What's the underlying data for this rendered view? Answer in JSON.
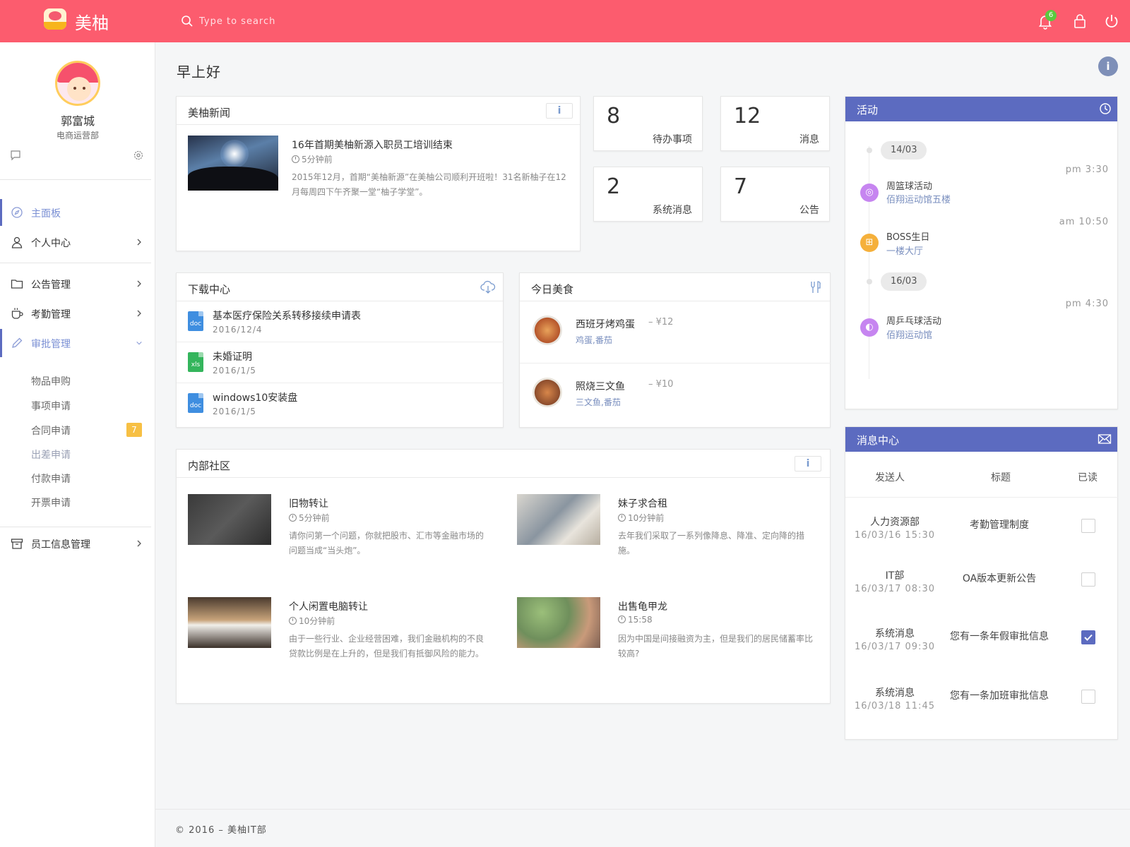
{
  "app": {
    "name": "美柚",
    "search_placeholder": "Type to search",
    "notification_count": "6"
  },
  "user": {
    "name": "郭富城",
    "dept": "电商运营部"
  },
  "sidebar": {
    "items": [
      {
        "label": "主面板",
        "icon": "dashboard-icon"
      },
      {
        "label": "个人中心",
        "icon": "user-icon"
      },
      {
        "label": "公告管理",
        "icon": "folder-icon"
      },
      {
        "label": "考勤管理",
        "icon": "coffee-icon"
      },
      {
        "label": "审批管理",
        "icon": "pencil-icon"
      },
      {
        "label": "员工信息管理",
        "icon": "archive-icon"
      }
    ],
    "sub_items": [
      {
        "label": "物品申购"
      },
      {
        "label": "事项申请"
      },
      {
        "label": "合同申请",
        "badge": "7"
      },
      {
        "label": "出差申请"
      },
      {
        "label": "付款申请"
      },
      {
        "label": "开票申请"
      }
    ]
  },
  "greeting": "早上好",
  "news": {
    "title": "美柚新闻",
    "item": {
      "title": "16年首期美柚新源入职员工培训结束",
      "time": "5分钟前",
      "desc": "2015年12月，首期“美柚新源”在美柚公司顺利开班啦！31名新柚子在12月每周四下午齐聚一堂“柚子学堂”。"
    }
  },
  "stats": [
    {
      "value": "8",
      "label": "待办事项"
    },
    {
      "value": "12",
      "label": "消息"
    },
    {
      "value": "2",
      "label": "系统消息"
    },
    {
      "value": "7",
      "label": "公告"
    }
  ],
  "downloads": {
    "title": "下载中心",
    "files": [
      {
        "name": "基本医疗保险关系转移接续申请表",
        "date": "2016/12/4",
        "type": "doc"
      },
      {
        "name": "未婚证明",
        "date": "2016/1/5",
        "type": "xls"
      },
      {
        "name": "windows10安装盘",
        "date": "2016/1/5",
        "type": "doc"
      }
    ]
  },
  "food": {
    "title": "今日美食",
    "items": [
      {
        "name": "西班牙烤鸡蛋",
        "price": "– ¥12",
        "tags": "鸡蛋,番茄"
      },
      {
        "name": "照烧三文鱼",
        "price": "– ¥10",
        "tags": "三文鱼,番茄"
      }
    ]
  },
  "community": {
    "title": "内部社区",
    "posts": [
      {
        "title": "旧物转让",
        "time": "5分钟前",
        "desc": "请你问第一个问题，你就把股市、汇市等金融市场的问题当成“当头炮”。"
      },
      {
        "title": "妹子求合租",
        "time": "10分钟前",
        "desc": "去年我们采取了一系列像降息、降准、定向降的措施。"
      },
      {
        "title": "个人闲置电脑转让",
        "time": "10分钟前",
        "desc": "由于一些行业、企业经营困难，我们金融机构的不良贷款比例是在上升的，但是我们有抵御风险的能力。"
      },
      {
        "title": "出售龟甲龙",
        "time": "15:58",
        "desc": "因为中国是间接融资为主，但是我们的居民储蓄率比较高?"
      }
    ]
  },
  "activity": {
    "title": "活动",
    "dates": [
      "14/03",
      "16/03"
    ],
    "events": [
      {
        "time": "pm 3:30",
        "title": "周篮球活动",
        "place": "佰翔运动馆五楼",
        "color": "#c685f0"
      },
      {
        "time": "am 10:50",
        "title": "BOSS生日",
        "place": "一楼大厅",
        "color": "#f5b03b"
      },
      {
        "time": "pm 4:30",
        "title": "周乒乓球活动",
        "place": "佰翔运动馆",
        "color": "#c685f0"
      }
    ]
  },
  "messages": {
    "title": "消息中心",
    "columns": [
      "发送人",
      "标题",
      "已读"
    ],
    "rows": [
      {
        "sender": "人力资源部",
        "time": "16/03/16 15:30",
        "title": "考勤管理制度",
        "read": false
      },
      {
        "sender": "IT部",
        "time": "16/03/17 08:30",
        "title": "OA版本更新公告",
        "read": false
      },
      {
        "sender": "系统消息",
        "time": "16/03/17 09:30",
        "title": "您有一条年假审批信息",
        "read": true
      },
      {
        "sender": "系统消息",
        "time": "16/03/18 11:45",
        "title": "您有一条加班审批信息",
        "read": false
      }
    ]
  },
  "footer": "© 2016 – 美柚IT部",
  "colors": {
    "topbar": "#fc5c6e",
    "accent": "#5c6bc0",
    "badge": "#f7c044"
  }
}
